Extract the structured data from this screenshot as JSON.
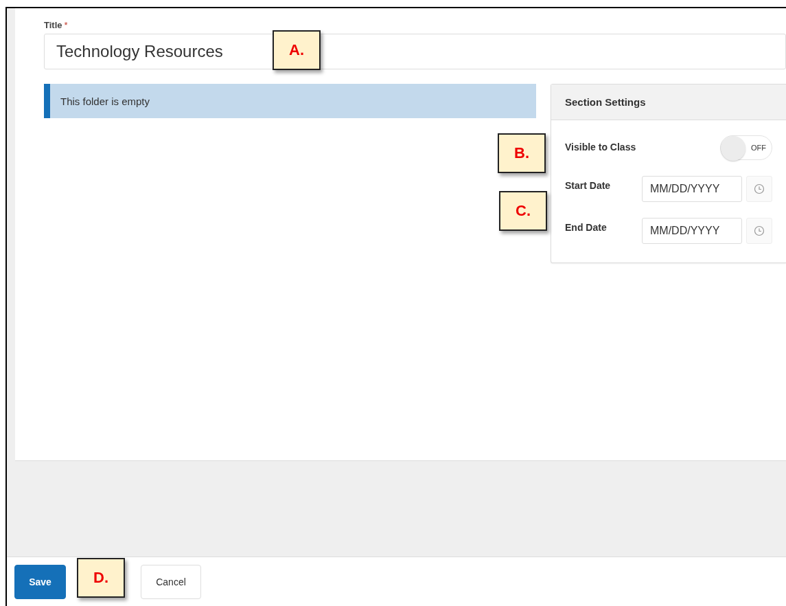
{
  "form": {
    "title_label": "Title",
    "required_mark": "*",
    "title_value": "Technology Resources"
  },
  "notice": "This folder is empty",
  "section_settings": {
    "heading": "Section Settings",
    "rows": [
      {
        "kind": "toggle",
        "label": "Visible to Class",
        "on": false,
        "off_text": "OFF"
      },
      {
        "kind": "date",
        "label": "Start Date",
        "placeholder": "MM/DD/YYYY"
      },
      {
        "kind": "date",
        "label": "End Date",
        "placeholder": "MM/DD/YYYY"
      }
    ]
  },
  "footer_buttons": [
    {
      "kind": "primary",
      "label": "Save"
    },
    {
      "kind": "secondary",
      "label": "Cancel"
    }
  ],
  "callouts": [
    {
      "label": "A."
    },
    {
      "label": "B."
    },
    {
      "label": "C."
    },
    {
      "label": "D."
    }
  ]
}
